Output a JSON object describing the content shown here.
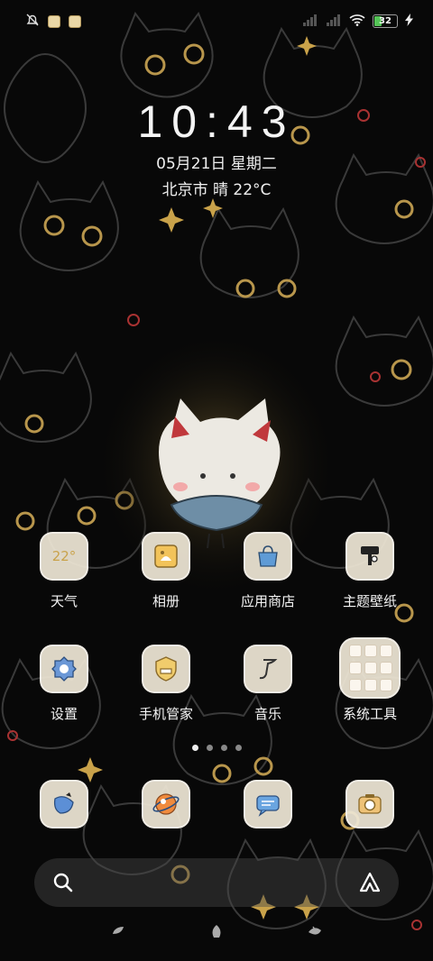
{
  "status_bar": {
    "battery_level": "32",
    "battery_percent": 0.32,
    "icons": [
      "notifications-muted-icon",
      "gallery-notification-icon",
      "album-notification-icon",
      "signal-1-icon",
      "signal-2-icon",
      "wifi-icon",
      "battery-icon",
      "charging-icon"
    ]
  },
  "clock": {
    "time": "10:43",
    "date": "05月21日 星期二",
    "weather": "北京市 晴 22°C"
  },
  "apps": {
    "row1": [
      {
        "label": "天气",
        "icon": "weather-icon",
        "badge": "22°"
      },
      {
        "label": "相册",
        "icon": "gallery-icon"
      },
      {
        "label": "应用商店",
        "icon": "app-store-icon"
      },
      {
        "label": "主题壁纸",
        "icon": "theme-wallpaper-icon"
      }
    ],
    "row2": [
      {
        "label": "设置",
        "icon": "settings-icon"
      },
      {
        "label": "手机管家",
        "icon": "phone-manager-icon"
      },
      {
        "label": "音乐",
        "icon": "music-icon"
      },
      {
        "label": "系统工具",
        "icon": "system-tools-folder-icon"
      }
    ]
  },
  "dock": [
    {
      "icon": "phone-icon"
    },
    {
      "icon": "browser-icon"
    },
    {
      "icon": "messages-icon"
    },
    {
      "icon": "camera-icon"
    }
  ],
  "page_indicator": {
    "pages": 4,
    "current": 1
  },
  "search": {
    "search_icon": "search-icon",
    "assistant_icon": "assistant-icon"
  },
  "navigation": [
    "back-gesture-icon",
    "home-gesture-icon",
    "recents-gesture-icon"
  ],
  "colors": {
    "accent_gold": "#c9a24a",
    "battery_green": "#55c457",
    "icon_bg": "#eee6d5"
  }
}
